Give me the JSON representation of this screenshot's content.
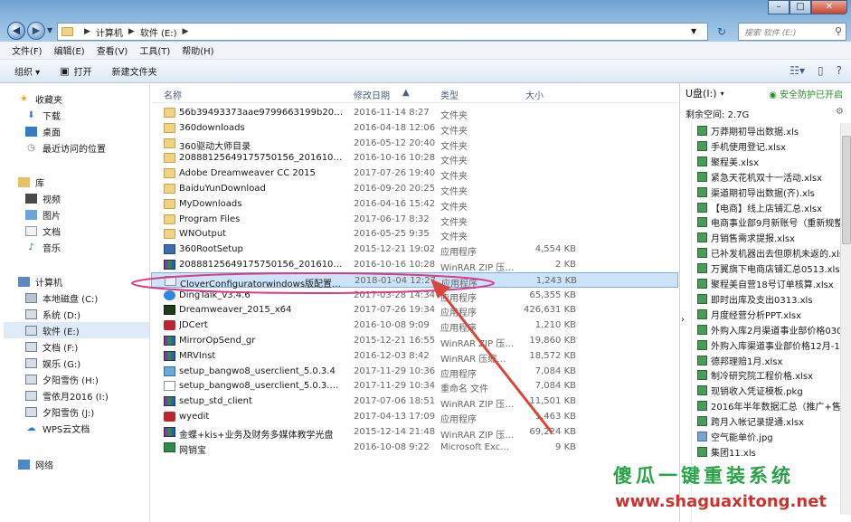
{
  "window": {
    "minimize": "–",
    "maximize": "□",
    "close": "✕"
  },
  "address": {
    "segments": [
      "计算机",
      "软件 (E:)"
    ],
    "search_placeholder": "搜索 软件 (E:)"
  },
  "menu": [
    "文件(F)",
    "编辑(E)",
    "查看(V)",
    "工具(T)",
    "帮助(H)"
  ],
  "toolbar": {
    "organize": "组织 ▾",
    "open": "打开",
    "new_folder": "新建文件夹"
  },
  "nav": {
    "favorites": "收藏夹",
    "downloads": "下载",
    "desktop": "桌面",
    "recent": "最近访问的位置",
    "libraries": "库",
    "videos": "视频",
    "pictures": "图片",
    "documents": "文档",
    "music": "音乐",
    "computer": "计算机",
    "drives": [
      "本地磁盘 (C:)",
      "系统 (D:)",
      "软件 (E:)",
      "文档 (F:)",
      "娱乐 (G:)",
      "夕阳雪伤 (H:)",
      "雪依月2016 (I:)",
      "夕阳雪伤 (J:)",
      "WPS云文档"
    ],
    "network": "网络"
  },
  "columns": {
    "name": "名称",
    "date": "修改日期",
    "type": "类型",
    "size": "大小"
  },
  "files": [
    {
      "name": "56b39493373aae9799663199b20c394c",
      "date": "2016-11-14 8:27",
      "type": "文件夹",
      "size": "",
      "icon": "folder"
    },
    {
      "name": "360downloads",
      "date": "2016-04-18 12:06",
      "type": "文件夹",
      "size": "",
      "icon": "folder"
    },
    {
      "name": "360驱动大师目录",
      "date": "2016-05-12 20:40",
      "type": "文件夹",
      "size": "",
      "icon": "folder"
    },
    {
      "name": "20888125649175750156_2016100100...",
      "date": "2016-10-16 10:28",
      "type": "文件夹",
      "size": "",
      "icon": "folder"
    },
    {
      "name": "Adobe Dreamweaver CC 2015",
      "date": "2017-07-26 19:40",
      "type": "文件夹",
      "size": "",
      "icon": "folder"
    },
    {
      "name": "BaiduYunDownload",
      "date": "2016-09-20 20:25",
      "type": "文件夹",
      "size": "",
      "icon": "folder"
    },
    {
      "name": "MyDownloads",
      "date": "2016-04-16 15:42",
      "type": "文件夹",
      "size": "",
      "icon": "folder"
    },
    {
      "name": "Program Files",
      "date": "2017-06-17 8:32",
      "type": "文件夹",
      "size": "",
      "icon": "folder"
    },
    {
      "name": "WNOutput",
      "date": "2016-05-25 9:35",
      "type": "文件夹",
      "size": "",
      "icon": "folder"
    },
    {
      "name": "360RootSetup",
      "date": "2015-12-21 19:02",
      "type": "应用程序",
      "size": "4,554 KB",
      "icon": "exe"
    },
    {
      "name": "20888125649175750156_2016100100...",
      "date": "2016-10-16 10:28",
      "type": "WinRAR ZIP 压缩...",
      "size": "2 KB",
      "icon": "rar"
    },
    {
      "name": "CloverConfiguratorwindows版配置工...",
      "date": "2018-01-04 12:27",
      "type": "应用程序",
      "size": "1,243 KB",
      "icon": "app",
      "selected": true
    },
    {
      "name": "DingTalk_v3.4.6",
      "date": "2017-03-28 14:34",
      "type": "应用程序",
      "size": "65,355 KB",
      "icon": "dt"
    },
    {
      "name": "Dreamweaver_2015_x64",
      "date": "2017-07-26 19:34",
      "type": "应用程序",
      "size": "426,631 KB",
      "icon": "dw"
    },
    {
      "name": "JDCert",
      "date": "2016-10-08 9:09",
      "type": "应用程序",
      "size": "1,210 KB",
      "icon": "red"
    },
    {
      "name": "MirrorOpSend_gr",
      "date": "2015-12-21 16:55",
      "type": "WinRAR ZIP 压缩...",
      "size": "19,860 KB",
      "icon": "rar"
    },
    {
      "name": "MRVInst",
      "date": "2016-12-03 8:42",
      "type": "WinRAR 压缩文件",
      "size": "18,572 KB",
      "icon": "rar"
    },
    {
      "name": "setup_bangwo8_userclient_5.0.3.4",
      "date": "2017-11-29 10:36",
      "type": "应用程序",
      "size": "7,084 KB",
      "icon": "set"
    },
    {
      "name": "setup_bangwo8_userclient_5.0.3.4.exe...",
      "date": "2017-11-29 10:34",
      "type": "重命名 文件",
      "size": "7,084 KB",
      "icon": "txt"
    },
    {
      "name": "setup_std_client",
      "date": "2017-07-06 18:51",
      "type": "WinRAR ZIP 压缩...",
      "size": "11,501 KB",
      "icon": "rar"
    },
    {
      "name": "wyedit",
      "date": "2017-04-13 17:09",
      "type": "应用程序",
      "size": "1,463 KB",
      "icon": "red"
    },
    {
      "name": "金蝶+kis+业务及财务多媒体教学光盘",
      "date": "2015-12-14 21:48",
      "type": "WinRAR ZIP 压缩...",
      "size": "69,224 KB",
      "icon": "rar"
    },
    {
      "name": "网销宝",
      "date": "2016-10-08 9:22",
      "type": "Microsoft Excel ...",
      "size": "9 KB",
      "icon": "xls"
    }
  ],
  "preview": {
    "drive": "U盘(I:)",
    "protection": "安全防护已开启",
    "free_space": "剩余空间: 2.7G",
    "items": [
      "万莽期初导出数据.xls",
      "手机使用登记.xlsx",
      "聚程美.xlsx",
      "紧急天花机双十一活动.xlsx",
      "渠道期初导出数据(齐).xls",
      "【电商】线上店铺汇总.xlsx",
      "电商事业部9月新账号（重新规整...",
      "月销售需求提报.xlsx",
      "已补发机器出去但原机未返的.xlsx",
      "万翼旗下电商店铺汇总0513.xlsx",
      "聚程美自营18号订单核算.xlsx",
      "即时出库及支出0313.xls",
      "月度经营分析PPT.xlsx",
      "外购入库2月渠道事业部价格030...",
      "外购入库渠道事业部价格12月-1...",
      "德邦理赔1月.xlsx",
      "制冷研究院工程价格.xlsx",
      "现销收入凭证模板.pkg",
      "2016年半年数据汇总（推广+售...",
      "跨月入帐记录提通.xlsx",
      "空气能单价.jpg",
      "集团11.xls"
    ]
  },
  "watermark": {
    "line1": "傻瓜一键重装系统",
    "line2": "www.shaguaxitong.net"
  },
  "colors": {
    "selection": "#cce4fb",
    "annotation": "#d63c8a",
    "arrow": "#d9443b"
  }
}
